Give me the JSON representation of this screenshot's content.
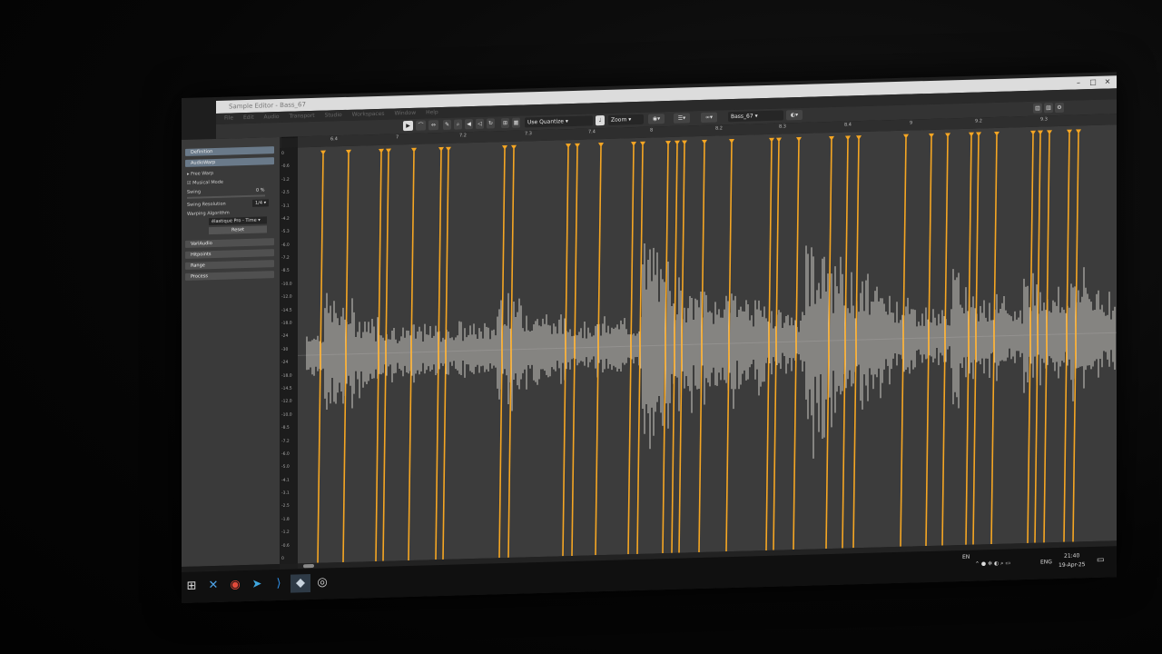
{
  "window": {
    "title": "Sample Editor - Bass_67",
    "controls": [
      "minimize-icon",
      "maximize-icon",
      "close-icon"
    ]
  },
  "menu": [
    "File",
    "Edit",
    "Audio",
    "Transport",
    "Studio",
    "Workspaces",
    "Window",
    "Help"
  ],
  "toolbar": {
    "quantize_label": "Use Quantize",
    "zoom_label": "Zoom",
    "event_name": "Bass_67"
  },
  "inspector": {
    "sections": [
      {
        "label": "Definition",
        "active": true
      },
      {
        "label": "AudioWarp",
        "active": true
      },
      {
        "label": "VariAudio",
        "active": false
      },
      {
        "label": "Hitpoints",
        "active": false
      },
      {
        "label": "Range",
        "active": false
      },
      {
        "label": "Process",
        "active": false
      }
    ],
    "free_warp": "Free Warp",
    "musical_mode": "Musical Mode",
    "swing_label": "Swing",
    "swing_value": "0 %",
    "swing_resolution_label": "Swing Resolution",
    "swing_resolution_value": "1/4",
    "warping_algorithm_label": "Warping Algorithm",
    "warping_algorithm_value": "élastique Pro - Time",
    "reset_label": "Reset"
  },
  "ruler": {
    "labels": [
      "6.4",
      "7",
      "7.2",
      "7.3",
      "7.4",
      "8",
      "8.2",
      "8.3",
      "8.4",
      "9",
      "9.2",
      "9.3"
    ]
  },
  "level_scale": [
    "0",
    "-0.6",
    "-1.2",
    "-2.5",
    "-3.1",
    "-4.2",
    "-5.3",
    "-6.0",
    "-7.2",
    "-8.5",
    "-10.0",
    "-12.0",
    "-14.5",
    "-18.0",
    "-24",
    "-30",
    "-24",
    "-18.0",
    "-14.5",
    "-12.0",
    "-10.0",
    "-8.5",
    "-7.2",
    "-6.0",
    "-5.0",
    "-4.1",
    "-3.1",
    "-2.5",
    "-1.8",
    "-1.2",
    "-0.6",
    "0"
  ],
  "taskbar": {
    "apps": [
      {
        "icon": "windows-start-icon",
        "glyph": "⊞",
        "color": "#dddddd"
      },
      {
        "icon": "xmind-icon",
        "glyph": "✕",
        "color": "#4ea3e6"
      },
      {
        "icon": "chrome-icon",
        "glyph": "◉",
        "color": "#e24a3b"
      },
      {
        "icon": "telegram-icon",
        "glyph": "➤",
        "color": "#3fa7e0"
      },
      {
        "icon": "vscode-icon",
        "glyph": "⟩",
        "color": "#2f8fe6"
      },
      {
        "icon": "cubase-icon",
        "glyph": "◆",
        "color": "#c9d4de"
      },
      {
        "icon": "obs-icon",
        "glyph": "◎",
        "color": "#cfcfcf"
      }
    ],
    "language_short": "EN",
    "language": "ENG",
    "time": "21:40",
    "date": "19-Apr-25"
  },
  "colors": {
    "warp_line": "#f5a623",
    "waveform": "#e8e4de",
    "editor_bg": "#3c3c3c"
  }
}
